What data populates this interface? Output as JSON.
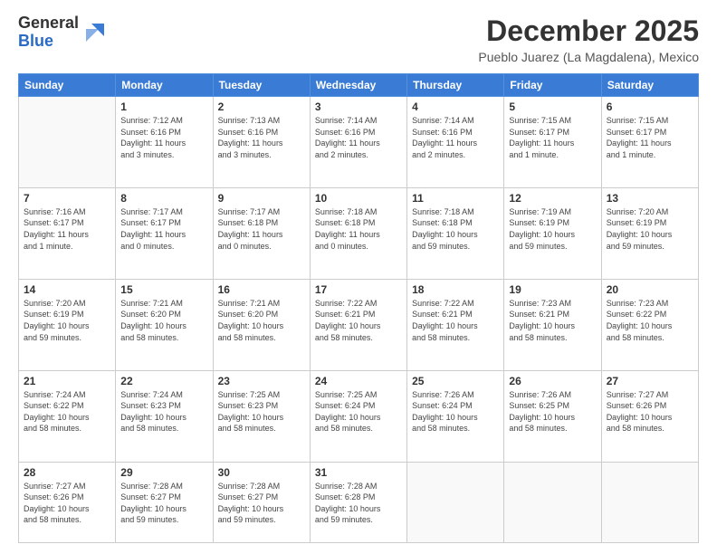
{
  "logo": {
    "general": "General",
    "blue": "Blue"
  },
  "title": "December 2025",
  "location": "Pueblo Juarez (La Magdalena), Mexico",
  "days_of_week": [
    "Sunday",
    "Monday",
    "Tuesday",
    "Wednesday",
    "Thursday",
    "Friday",
    "Saturday"
  ],
  "weeks": [
    [
      {
        "day": "",
        "info": ""
      },
      {
        "day": "1",
        "info": "Sunrise: 7:12 AM\nSunset: 6:16 PM\nDaylight: 11 hours\nand 3 minutes."
      },
      {
        "day": "2",
        "info": "Sunrise: 7:13 AM\nSunset: 6:16 PM\nDaylight: 11 hours\nand 3 minutes."
      },
      {
        "day": "3",
        "info": "Sunrise: 7:14 AM\nSunset: 6:16 PM\nDaylight: 11 hours\nand 2 minutes."
      },
      {
        "day": "4",
        "info": "Sunrise: 7:14 AM\nSunset: 6:16 PM\nDaylight: 11 hours\nand 2 minutes."
      },
      {
        "day": "5",
        "info": "Sunrise: 7:15 AM\nSunset: 6:17 PM\nDaylight: 11 hours\nand 1 minute."
      },
      {
        "day": "6",
        "info": "Sunrise: 7:15 AM\nSunset: 6:17 PM\nDaylight: 11 hours\nand 1 minute."
      }
    ],
    [
      {
        "day": "7",
        "info": "Sunrise: 7:16 AM\nSunset: 6:17 PM\nDaylight: 11 hours\nand 1 minute."
      },
      {
        "day": "8",
        "info": "Sunrise: 7:17 AM\nSunset: 6:17 PM\nDaylight: 11 hours\nand 0 minutes."
      },
      {
        "day": "9",
        "info": "Sunrise: 7:17 AM\nSunset: 6:18 PM\nDaylight: 11 hours\nand 0 minutes."
      },
      {
        "day": "10",
        "info": "Sunrise: 7:18 AM\nSunset: 6:18 PM\nDaylight: 11 hours\nand 0 minutes."
      },
      {
        "day": "11",
        "info": "Sunrise: 7:18 AM\nSunset: 6:18 PM\nDaylight: 10 hours\nand 59 minutes."
      },
      {
        "day": "12",
        "info": "Sunrise: 7:19 AM\nSunset: 6:19 PM\nDaylight: 10 hours\nand 59 minutes."
      },
      {
        "day": "13",
        "info": "Sunrise: 7:20 AM\nSunset: 6:19 PM\nDaylight: 10 hours\nand 59 minutes."
      }
    ],
    [
      {
        "day": "14",
        "info": "Sunrise: 7:20 AM\nSunset: 6:19 PM\nDaylight: 10 hours\nand 59 minutes."
      },
      {
        "day": "15",
        "info": "Sunrise: 7:21 AM\nSunset: 6:20 PM\nDaylight: 10 hours\nand 58 minutes."
      },
      {
        "day": "16",
        "info": "Sunrise: 7:21 AM\nSunset: 6:20 PM\nDaylight: 10 hours\nand 58 minutes."
      },
      {
        "day": "17",
        "info": "Sunrise: 7:22 AM\nSunset: 6:21 PM\nDaylight: 10 hours\nand 58 minutes."
      },
      {
        "day": "18",
        "info": "Sunrise: 7:22 AM\nSunset: 6:21 PM\nDaylight: 10 hours\nand 58 minutes."
      },
      {
        "day": "19",
        "info": "Sunrise: 7:23 AM\nSunset: 6:21 PM\nDaylight: 10 hours\nand 58 minutes."
      },
      {
        "day": "20",
        "info": "Sunrise: 7:23 AM\nSunset: 6:22 PM\nDaylight: 10 hours\nand 58 minutes."
      }
    ],
    [
      {
        "day": "21",
        "info": "Sunrise: 7:24 AM\nSunset: 6:22 PM\nDaylight: 10 hours\nand 58 minutes."
      },
      {
        "day": "22",
        "info": "Sunrise: 7:24 AM\nSunset: 6:23 PM\nDaylight: 10 hours\nand 58 minutes."
      },
      {
        "day": "23",
        "info": "Sunrise: 7:25 AM\nSunset: 6:23 PM\nDaylight: 10 hours\nand 58 minutes."
      },
      {
        "day": "24",
        "info": "Sunrise: 7:25 AM\nSunset: 6:24 PM\nDaylight: 10 hours\nand 58 minutes."
      },
      {
        "day": "25",
        "info": "Sunrise: 7:26 AM\nSunset: 6:24 PM\nDaylight: 10 hours\nand 58 minutes."
      },
      {
        "day": "26",
        "info": "Sunrise: 7:26 AM\nSunset: 6:25 PM\nDaylight: 10 hours\nand 58 minutes."
      },
      {
        "day": "27",
        "info": "Sunrise: 7:27 AM\nSunset: 6:26 PM\nDaylight: 10 hours\nand 58 minutes."
      }
    ],
    [
      {
        "day": "28",
        "info": "Sunrise: 7:27 AM\nSunset: 6:26 PM\nDaylight: 10 hours\nand 58 minutes."
      },
      {
        "day": "29",
        "info": "Sunrise: 7:28 AM\nSunset: 6:27 PM\nDaylight: 10 hours\nand 59 minutes."
      },
      {
        "day": "30",
        "info": "Sunrise: 7:28 AM\nSunset: 6:27 PM\nDaylight: 10 hours\nand 59 minutes."
      },
      {
        "day": "31",
        "info": "Sunrise: 7:28 AM\nSunset: 6:28 PM\nDaylight: 10 hours\nand 59 minutes."
      },
      {
        "day": "",
        "info": ""
      },
      {
        "day": "",
        "info": ""
      },
      {
        "day": "",
        "info": ""
      }
    ]
  ]
}
